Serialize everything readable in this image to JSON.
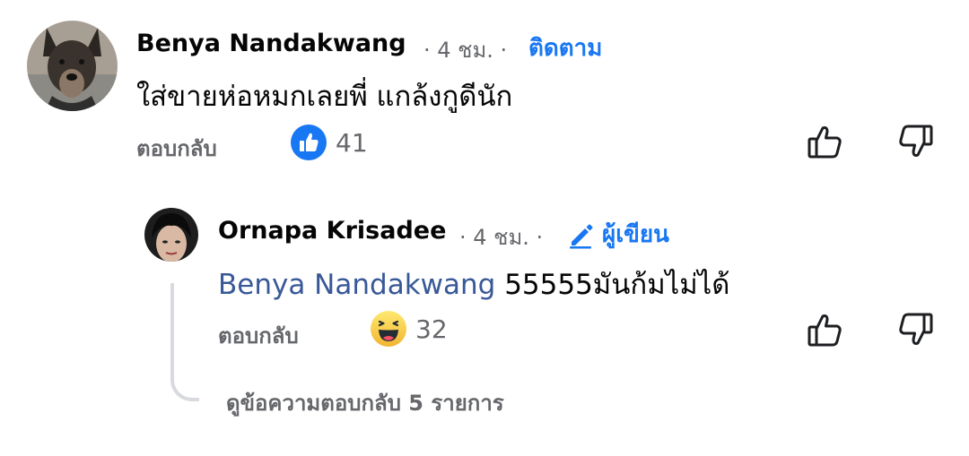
{
  "comments": [
    {
      "author": "Benya Nandakwang",
      "time": "· 4 ชม. ·",
      "follow_label": "ติดตาม",
      "text": "ใส่ขายห่อหมกเลยพี่ แกล้งกูดีนัก",
      "reply_label": "ตอบกลับ",
      "reaction_count": "41",
      "reaction_type": "like-icon"
    },
    {
      "author": "Ornapa Krisadee",
      "time": "· 4 ชม. ·",
      "author_badge": "ผู้เขียน",
      "mention": "Benya Nandakwang",
      "text": "55555มันก้มไม่ได้",
      "reply_label": "ตอบกลับ",
      "reaction_count": "32",
      "reaction_type": "haha-icon"
    }
  ],
  "view_replies_label": "ดูข้อความตอบกลับ 5 รายการ",
  "colors": {
    "accent": "#1877f2",
    "muted": "#65676b",
    "mention": "#385898"
  }
}
